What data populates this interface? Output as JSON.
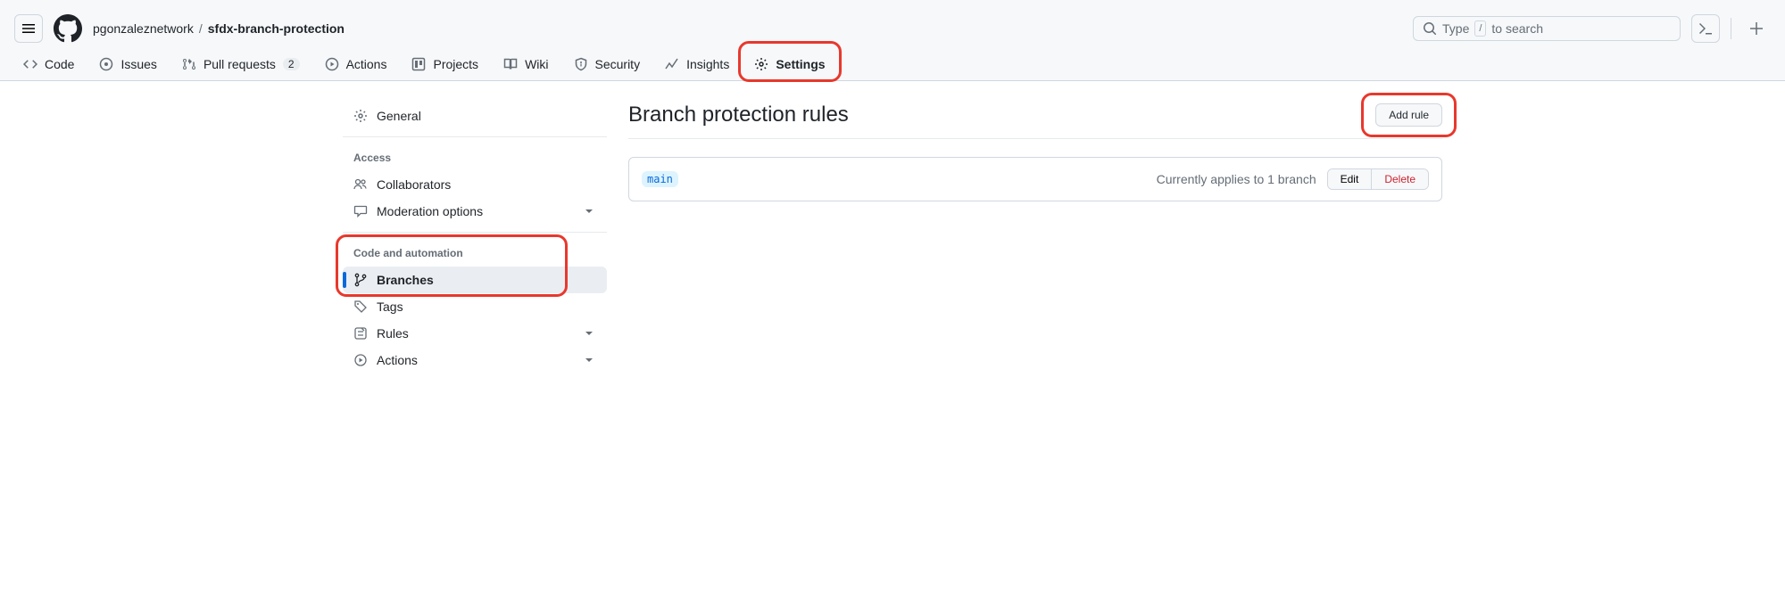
{
  "header": {
    "owner": "pgonzaleznetwork",
    "separator": "/",
    "repo": "sfdx-branch-protection",
    "search_placeholder": "Type",
    "search_hint_key": "/",
    "search_suffix": "to search"
  },
  "repo_nav": {
    "code": "Code",
    "issues": "Issues",
    "pulls": "Pull requests",
    "pulls_count": "2",
    "actions": "Actions",
    "projects": "Projects",
    "wiki": "Wiki",
    "security": "Security",
    "insights": "Insights",
    "settings": "Settings"
  },
  "sidebar": {
    "general": "General",
    "access_header": "Access",
    "collaborators": "Collaborators",
    "moderation": "Moderation options",
    "code_auto_header": "Code and automation",
    "branches": "Branches",
    "tags": "Tags",
    "rules": "Rules",
    "actions": "Actions"
  },
  "content": {
    "title": "Branch protection rules",
    "add_rule": "Add rule",
    "branch_name": "main",
    "applies_text": "Currently applies to 1 branch",
    "edit": "Edit",
    "delete": "Delete"
  }
}
